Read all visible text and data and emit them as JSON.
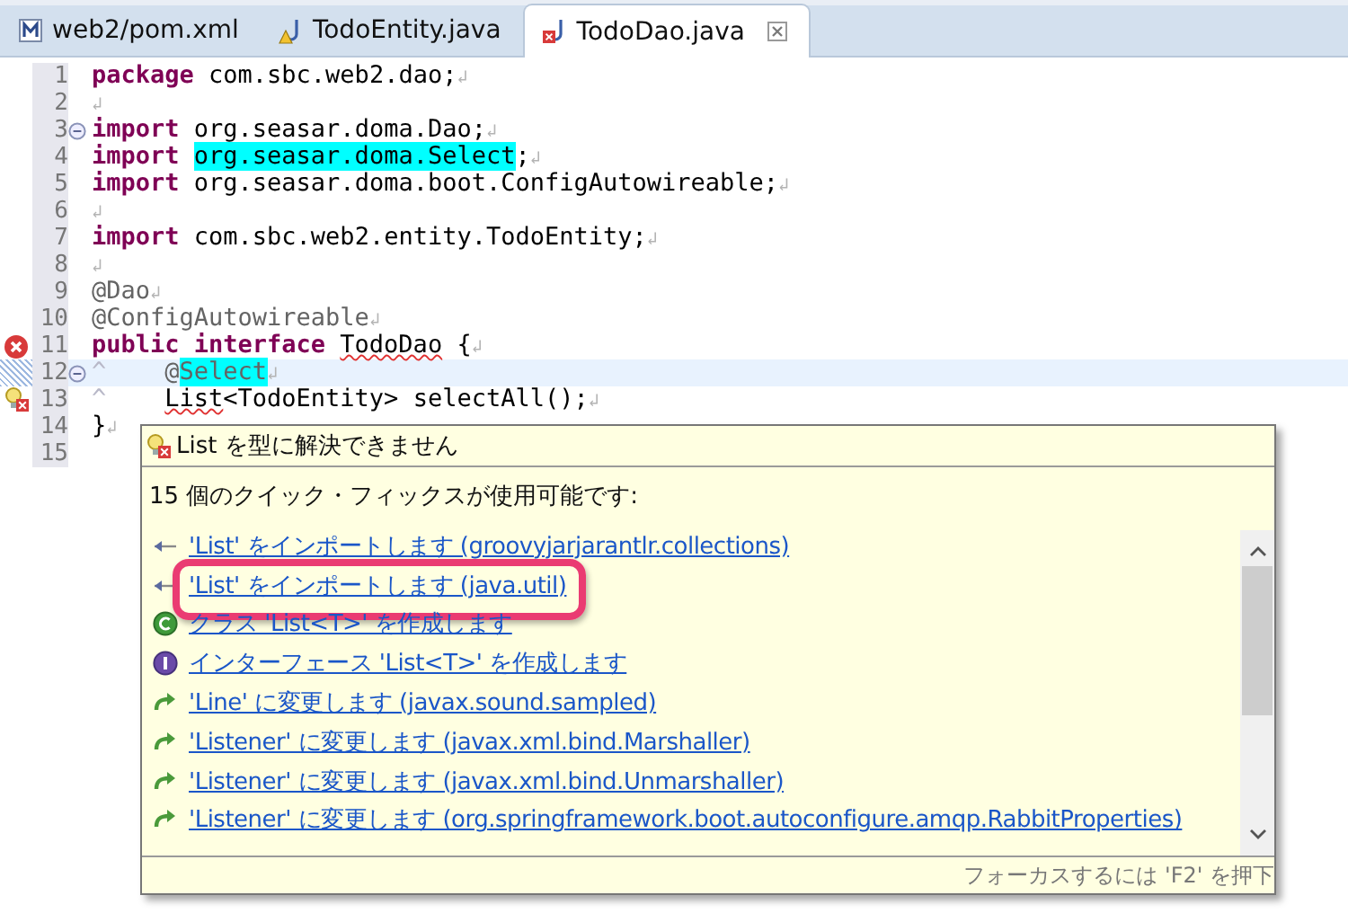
{
  "tabs": [
    {
      "label": "web2/pom.xml",
      "kind": "maven",
      "has_warning": false,
      "has_error": false,
      "selected": false
    },
    {
      "label": "TodoEntity.java",
      "kind": "java",
      "has_warning": true,
      "has_error": false,
      "selected": false
    },
    {
      "label": "TodoDao.java",
      "kind": "java",
      "has_warning": false,
      "has_error": true,
      "selected": true
    }
  ],
  "editor": {
    "lines": [
      {
        "number": "1",
        "folding": false,
        "current": false,
        "error": false,
        "quick_fix": false,
        "segments": [
          {
            "kind": "keyword",
            "text": "package"
          },
          {
            "kind": "text",
            "text": " com.sbc.web2.dao;"
          },
          {
            "kind": "eol",
            "text": "↲"
          }
        ]
      },
      {
        "number": "2",
        "folding": false,
        "current": false,
        "error": false,
        "quick_fix": false,
        "segments": [
          {
            "kind": "eol",
            "text": "↲"
          }
        ]
      },
      {
        "number": "3",
        "folding": true,
        "current": false,
        "error": false,
        "quick_fix": false,
        "segments": [
          {
            "kind": "keyword",
            "text": "import"
          },
          {
            "kind": "text",
            "text": " org.seasar.doma.Dao;"
          },
          {
            "kind": "eol",
            "text": "↲"
          }
        ]
      },
      {
        "number": "4",
        "folding": false,
        "current": false,
        "error": false,
        "quick_fix": false,
        "segments": [
          {
            "kind": "keyword",
            "text": "import "
          },
          {
            "kind": "match",
            "text": "org.seasar.doma.Select"
          },
          {
            "kind": "text",
            "text": ";"
          },
          {
            "kind": "eol",
            "text": "↲"
          }
        ]
      },
      {
        "number": "5",
        "folding": false,
        "current": false,
        "error": false,
        "quick_fix": false,
        "segments": [
          {
            "kind": "keyword",
            "text": "import"
          },
          {
            "kind": "text",
            "text": " org.seasar.doma.boot.ConfigAutowireable;"
          },
          {
            "kind": "eol",
            "text": "↲"
          }
        ]
      },
      {
        "number": "6",
        "folding": false,
        "current": false,
        "error": false,
        "quick_fix": false,
        "segments": [
          {
            "kind": "eol",
            "text": "↲"
          }
        ]
      },
      {
        "number": "7",
        "folding": false,
        "current": false,
        "error": false,
        "quick_fix": false,
        "segments": [
          {
            "kind": "keyword",
            "text": "import"
          },
          {
            "kind": "text",
            "text": " com.sbc.web2.entity.TodoEntity;"
          },
          {
            "kind": "eol",
            "text": "↲"
          }
        ]
      },
      {
        "number": "8",
        "folding": false,
        "current": false,
        "error": false,
        "quick_fix": false,
        "segments": [
          {
            "kind": "eol",
            "text": "↲"
          }
        ]
      },
      {
        "number": "9",
        "folding": false,
        "current": false,
        "error": false,
        "quick_fix": false,
        "segments": [
          {
            "kind": "annotation",
            "text": "@Dao"
          },
          {
            "kind": "eol",
            "text": "↲"
          }
        ]
      },
      {
        "number": "10",
        "folding": false,
        "current": false,
        "error": false,
        "quick_fix": false,
        "segments": [
          {
            "kind": "annotation",
            "text": "@ConfigAutowireable"
          },
          {
            "kind": "eol",
            "text": "↲"
          }
        ]
      },
      {
        "number": "11",
        "folding": false,
        "current": false,
        "error": true,
        "quick_fix": false,
        "segments": [
          {
            "kind": "keyword",
            "text": "public interface "
          },
          {
            "kind": "error",
            "text": "TodoDao"
          },
          {
            "kind": "text",
            "text": " {"
          },
          {
            "kind": "eol",
            "text": "↲"
          }
        ]
      },
      {
        "number": "12",
        "folding": true,
        "current": true,
        "error": false,
        "quick_fix": false,
        "segments": [
          {
            "kind": "faint",
            "text": "^    "
          },
          {
            "kind": "annotation",
            "text": "@"
          },
          {
            "kind": "annotation-match",
            "text": "Select"
          },
          {
            "kind": "eol",
            "text": "↲"
          }
        ]
      },
      {
        "number": "13",
        "folding": false,
        "current": false,
        "error": false,
        "quick_fix": true,
        "segments": [
          {
            "kind": "faint",
            "text": "^    "
          },
          {
            "kind": "error",
            "text": "List"
          },
          {
            "kind": "text",
            "text": "<TodoEntity> selectAll();"
          },
          {
            "kind": "eol",
            "text": "↲"
          }
        ]
      },
      {
        "number": "14",
        "folding": false,
        "current": false,
        "error": false,
        "quick_fix": false,
        "segments": [
          {
            "kind": "text",
            "text": "}"
          },
          {
            "kind": "eol",
            "text": "↲"
          }
        ]
      },
      {
        "number": "15",
        "folding": false,
        "current": false,
        "error": false,
        "quick_fix": false
      }
    ]
  },
  "quick_fix_popup": {
    "title": "List を型に解決できません",
    "heading": "15 個のクイック・フィックスが使用可能です:",
    "fixes": [
      {
        "kind": "import",
        "label": "'List' をインポートします (groovyjarjarantlr.collections)",
        "highlighted": false
      },
      {
        "kind": "import",
        "label": "'List' をインポートします (java.util)",
        "highlighted": true
      },
      {
        "kind": "class",
        "label": "クラス 'List<T>' を作成します",
        "highlighted": false
      },
      {
        "kind": "interface",
        "label": "インターフェース 'List<T>' を作成します",
        "highlighted": false
      },
      {
        "kind": "change",
        "label": "'Line' に変更します (javax.sound.sampled)",
        "highlighted": false
      },
      {
        "kind": "change",
        "label": "'Listener' に変更します (javax.xml.bind.Marshaller)",
        "highlighted": false
      },
      {
        "kind": "change",
        "label": "'Listener' に変更します (javax.xml.bind.Unmarshaller)",
        "highlighted": false
      },
      {
        "kind": "change",
        "label": "'Listener' に変更します (org.springframework.boot.autoconfigure.amqp.RabbitProperties)",
        "highlighted": false
      }
    ],
    "footer": "フォーカスするには 'F2' を押下"
  }
}
